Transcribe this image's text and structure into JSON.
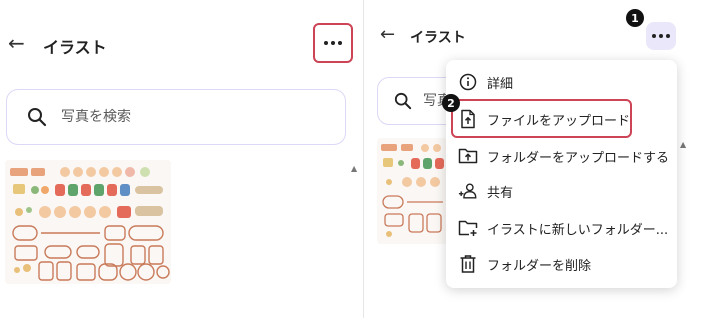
{
  "left_panel": {
    "back_icon": "arrow-left-icon",
    "title": "イラスト",
    "more_icon": "more-horizontal-icon",
    "search": {
      "placeholder": "写真を検索"
    }
  },
  "right_panel": {
    "back_icon": "arrow-left-icon",
    "title": "イラスト",
    "more_icon": "more-horizontal-icon",
    "search": {
      "placeholder": "写真を検索"
    }
  },
  "context_menu": {
    "items": [
      {
        "icon": "info-icon",
        "label": "詳細"
      },
      {
        "icon": "file-upload-icon",
        "label": "ファイルをアップロード"
      },
      {
        "icon": "folder-upload-icon",
        "label": "フォルダーをアップロードする"
      },
      {
        "icon": "share-icon",
        "label": "共有"
      },
      {
        "icon": "new-folder-icon",
        "label": "イラストに新しいフォルダー..."
      },
      {
        "icon": "trash-icon",
        "label": "フォルダーを削除"
      }
    ]
  },
  "annotations": {
    "step1": "1",
    "step2": "2"
  },
  "colors": {
    "highlight_border": "#cc4455",
    "more_button_bg": "#ebe7fb",
    "search_border": "#dcd8f6"
  }
}
